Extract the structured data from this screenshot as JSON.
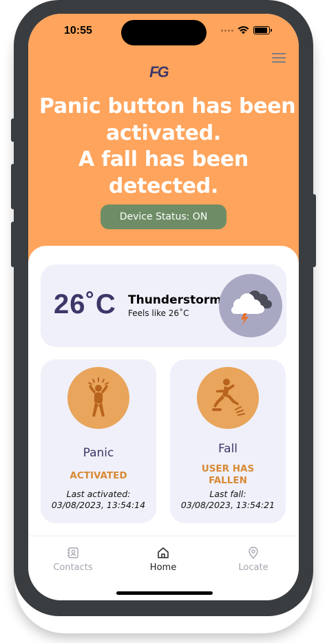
{
  "status_bar": {
    "time": "10:55"
  },
  "header": {
    "logo": "FG",
    "headline": [
      "Panic button has been",
      "activated.",
      "A fall has been",
      "detected."
    ],
    "device_status": "Device Status: ON",
    "background_color": "#ffa45c"
  },
  "weather": {
    "temperature": "26˚C",
    "condition": "Thunderstorm",
    "feels_like": "Feels like 26˚C",
    "icon": "thunderstorm-cloud-icon"
  },
  "alerts": {
    "panic": {
      "title": "Panic",
      "status": "ACTIVATED",
      "time_label": "Last activated:",
      "time_value": "03/08/2023, 13:54:14",
      "icon": "panic-person-icon"
    },
    "fall": {
      "title": "Fall",
      "status_line1": "USER HAS",
      "status_line2": "FALLEN",
      "time_label": "Last fall:",
      "time_value": "03/08/2023, 13:54:21",
      "icon": "falling-person-icon"
    }
  },
  "tabbar": {
    "tabs": [
      {
        "label": "Contacts",
        "icon": "contacts-icon",
        "active": false
      },
      {
        "label": "Home",
        "icon": "home-icon",
        "active": true
      },
      {
        "label": "Locate",
        "icon": "location-pin-icon",
        "active": false
      }
    ]
  },
  "colors": {
    "accent": "#ffa45c",
    "primary_text": "#3c3769",
    "status_green": "#6e8d66",
    "alert_orange": "#d88a35",
    "card_bg": "#f0f0fa"
  }
}
